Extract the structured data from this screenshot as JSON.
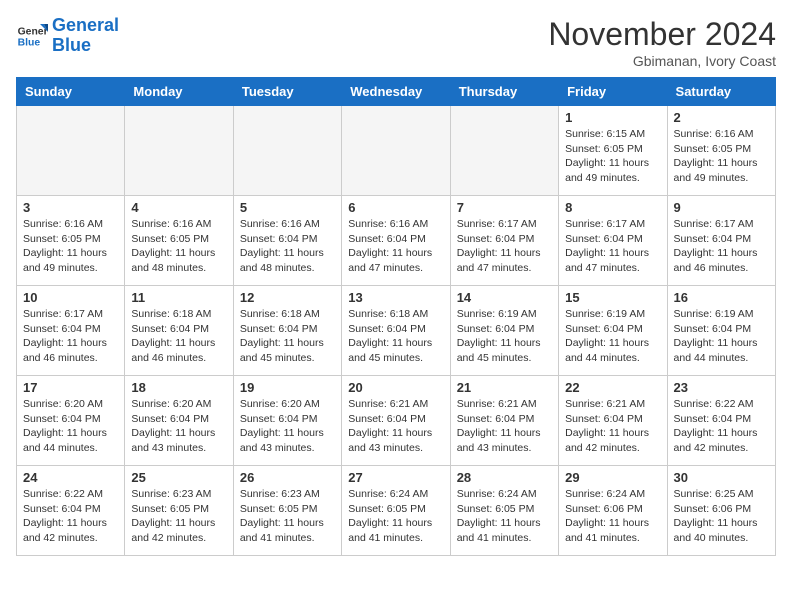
{
  "header": {
    "logo_line1": "General",
    "logo_line2": "Blue",
    "month_title": "November 2024",
    "subtitle": "Gbimanan, Ivory Coast"
  },
  "days_of_week": [
    "Sunday",
    "Monday",
    "Tuesday",
    "Wednesday",
    "Thursday",
    "Friday",
    "Saturday"
  ],
  "weeks": [
    [
      {
        "day": "",
        "info": ""
      },
      {
        "day": "",
        "info": ""
      },
      {
        "day": "",
        "info": ""
      },
      {
        "day": "",
        "info": ""
      },
      {
        "day": "",
        "info": ""
      },
      {
        "day": "1",
        "info": "Sunrise: 6:15 AM\nSunset: 6:05 PM\nDaylight: 11 hours\nand 49 minutes."
      },
      {
        "day": "2",
        "info": "Sunrise: 6:16 AM\nSunset: 6:05 PM\nDaylight: 11 hours\nand 49 minutes."
      }
    ],
    [
      {
        "day": "3",
        "info": "Sunrise: 6:16 AM\nSunset: 6:05 PM\nDaylight: 11 hours\nand 49 minutes."
      },
      {
        "day": "4",
        "info": "Sunrise: 6:16 AM\nSunset: 6:05 PM\nDaylight: 11 hours\nand 48 minutes."
      },
      {
        "day": "5",
        "info": "Sunrise: 6:16 AM\nSunset: 6:04 PM\nDaylight: 11 hours\nand 48 minutes."
      },
      {
        "day": "6",
        "info": "Sunrise: 6:16 AM\nSunset: 6:04 PM\nDaylight: 11 hours\nand 47 minutes."
      },
      {
        "day": "7",
        "info": "Sunrise: 6:17 AM\nSunset: 6:04 PM\nDaylight: 11 hours\nand 47 minutes."
      },
      {
        "day": "8",
        "info": "Sunrise: 6:17 AM\nSunset: 6:04 PM\nDaylight: 11 hours\nand 47 minutes."
      },
      {
        "day": "9",
        "info": "Sunrise: 6:17 AM\nSunset: 6:04 PM\nDaylight: 11 hours\nand 46 minutes."
      }
    ],
    [
      {
        "day": "10",
        "info": "Sunrise: 6:17 AM\nSunset: 6:04 PM\nDaylight: 11 hours\nand 46 minutes."
      },
      {
        "day": "11",
        "info": "Sunrise: 6:18 AM\nSunset: 6:04 PM\nDaylight: 11 hours\nand 46 minutes."
      },
      {
        "day": "12",
        "info": "Sunrise: 6:18 AM\nSunset: 6:04 PM\nDaylight: 11 hours\nand 45 minutes."
      },
      {
        "day": "13",
        "info": "Sunrise: 6:18 AM\nSunset: 6:04 PM\nDaylight: 11 hours\nand 45 minutes."
      },
      {
        "day": "14",
        "info": "Sunrise: 6:19 AM\nSunset: 6:04 PM\nDaylight: 11 hours\nand 45 minutes."
      },
      {
        "day": "15",
        "info": "Sunrise: 6:19 AM\nSunset: 6:04 PM\nDaylight: 11 hours\nand 44 minutes."
      },
      {
        "day": "16",
        "info": "Sunrise: 6:19 AM\nSunset: 6:04 PM\nDaylight: 11 hours\nand 44 minutes."
      }
    ],
    [
      {
        "day": "17",
        "info": "Sunrise: 6:20 AM\nSunset: 6:04 PM\nDaylight: 11 hours\nand 44 minutes."
      },
      {
        "day": "18",
        "info": "Sunrise: 6:20 AM\nSunset: 6:04 PM\nDaylight: 11 hours\nand 43 minutes."
      },
      {
        "day": "19",
        "info": "Sunrise: 6:20 AM\nSunset: 6:04 PM\nDaylight: 11 hours\nand 43 minutes."
      },
      {
        "day": "20",
        "info": "Sunrise: 6:21 AM\nSunset: 6:04 PM\nDaylight: 11 hours\nand 43 minutes."
      },
      {
        "day": "21",
        "info": "Sunrise: 6:21 AM\nSunset: 6:04 PM\nDaylight: 11 hours\nand 43 minutes."
      },
      {
        "day": "22",
        "info": "Sunrise: 6:21 AM\nSunset: 6:04 PM\nDaylight: 11 hours\nand 42 minutes."
      },
      {
        "day": "23",
        "info": "Sunrise: 6:22 AM\nSunset: 6:04 PM\nDaylight: 11 hours\nand 42 minutes."
      }
    ],
    [
      {
        "day": "24",
        "info": "Sunrise: 6:22 AM\nSunset: 6:04 PM\nDaylight: 11 hours\nand 42 minutes."
      },
      {
        "day": "25",
        "info": "Sunrise: 6:23 AM\nSunset: 6:05 PM\nDaylight: 11 hours\nand 42 minutes."
      },
      {
        "day": "26",
        "info": "Sunrise: 6:23 AM\nSunset: 6:05 PM\nDaylight: 11 hours\nand 41 minutes."
      },
      {
        "day": "27",
        "info": "Sunrise: 6:24 AM\nSunset: 6:05 PM\nDaylight: 11 hours\nand 41 minutes."
      },
      {
        "day": "28",
        "info": "Sunrise: 6:24 AM\nSunset: 6:05 PM\nDaylight: 11 hours\nand 41 minutes."
      },
      {
        "day": "29",
        "info": "Sunrise: 6:24 AM\nSunset: 6:06 PM\nDaylight: 11 hours\nand 41 minutes."
      },
      {
        "day": "30",
        "info": "Sunrise: 6:25 AM\nSunset: 6:06 PM\nDaylight: 11 hours\nand 40 minutes."
      }
    ]
  ]
}
